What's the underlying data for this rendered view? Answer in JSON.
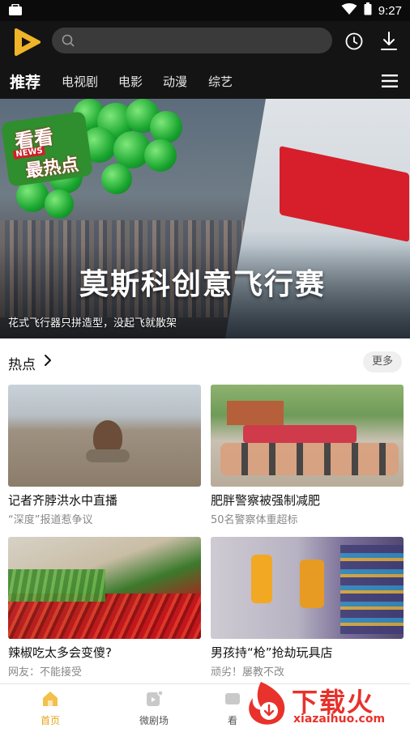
{
  "status_bar": {
    "time": "9:27"
  },
  "search": {
    "placeholder": ""
  },
  "nav_tabs": [
    {
      "label": "推荐",
      "active": true
    },
    {
      "label": "电视剧"
    },
    {
      "label": "电影"
    },
    {
      "label": "动漫"
    },
    {
      "label": "综艺"
    }
  ],
  "banner": {
    "badge_line1": "看看",
    "badge_line2": "NEWS",
    "badge_line3": "最热点",
    "title": "莫斯科创意飞行赛",
    "subtitle": "花式飞行器只拼造型，没起飞就散架"
  },
  "section": {
    "title": "热点",
    "more_label": "更多"
  },
  "cards": [
    {
      "title": "记者齐脖洪水中直播",
      "subtitle": "“深度”报道惹争议"
    },
    {
      "title": "肥胖警察被强制减肥",
      "subtitle": "50名警察体重超标"
    },
    {
      "title": "辣椒吃太多会变傻?",
      "subtitle": "网友：不能接受"
    },
    {
      "title": "男孩持“枪”抢劫玩具店",
      "subtitle": "顽劣！屡教不改"
    }
  ],
  "bottom_nav": [
    {
      "label": "首页",
      "icon": "home-icon",
      "active": true
    },
    {
      "label": "微剧场",
      "icon": "theater-icon"
    },
    {
      "label": "看",
      "icon": "watch-icon"
    }
  ],
  "watermark": {
    "text_cn": "下载火",
    "text_en": "xiazaihuo.com"
  },
  "colors": {
    "accent": "#e6a317",
    "header_bg": "#141414",
    "watermark_red": "#e8322b"
  }
}
